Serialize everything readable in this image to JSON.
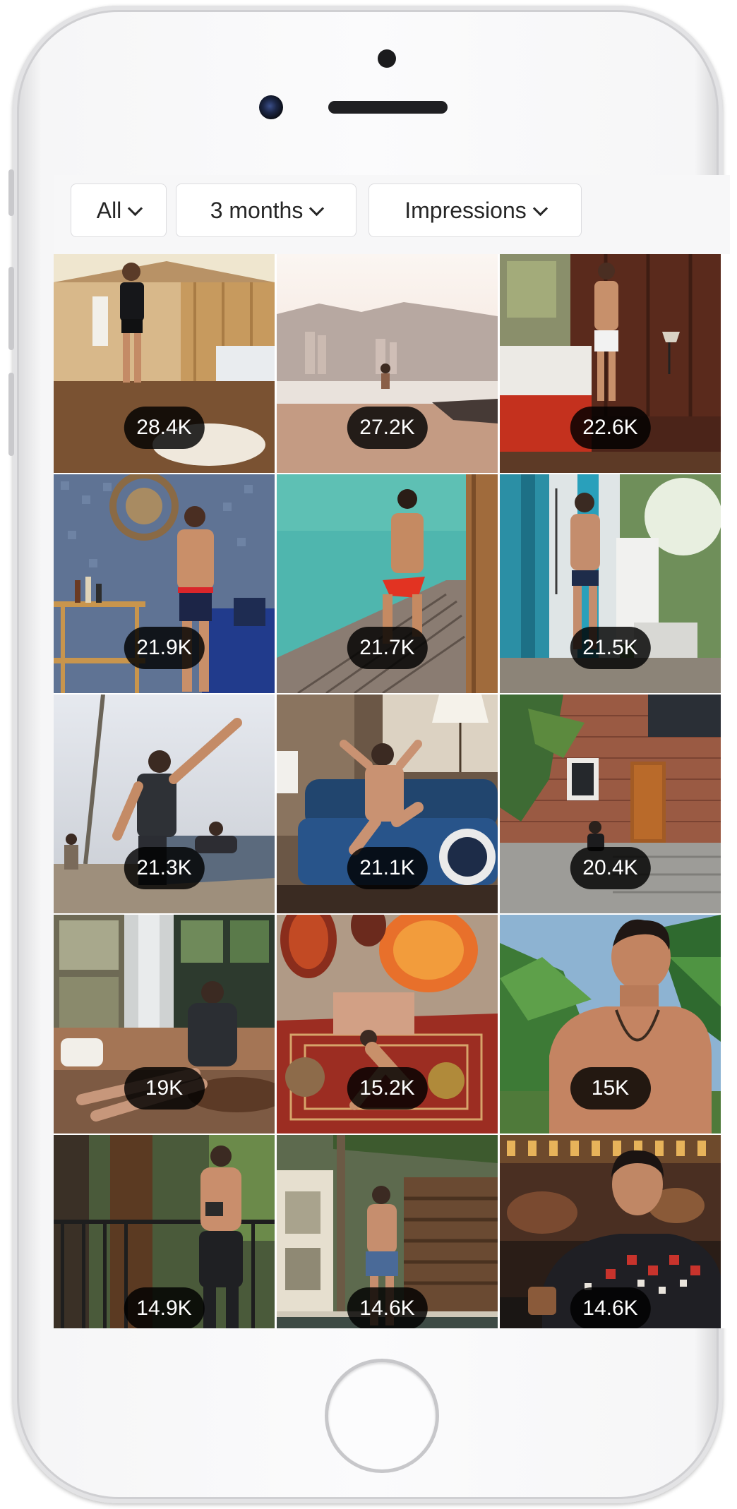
{
  "filters": {
    "content_type": "All",
    "time_range": "3 months",
    "metric": "Impressions"
  },
  "posts": [
    {
      "impressions": "28.4K",
      "scene": "tent-bedroom"
    },
    {
      "impressions": "27.2K",
      "scene": "beach-city"
    },
    {
      "impressions": "22.6K",
      "scene": "red-bedroom"
    },
    {
      "impressions": "21.9K",
      "scene": "mosaic-bar-cart"
    },
    {
      "impressions": "21.7K",
      "scene": "water-dock"
    },
    {
      "impressions": "21.5K",
      "scene": "outdoor-shower"
    },
    {
      "impressions": "21.3K",
      "scene": "beach-yoga"
    },
    {
      "impressions": "21.1K",
      "scene": "blue-sofa"
    },
    {
      "impressions": "20.4K",
      "scene": "brick-house"
    },
    {
      "impressions": "19K",
      "scene": "window-lounge"
    },
    {
      "impressions": "15.2K",
      "scene": "lanterns-rug"
    },
    {
      "impressions": "15K",
      "scene": "palm-portrait"
    },
    {
      "impressions": "14.9K",
      "scene": "forest-balcony"
    },
    {
      "impressions": "14.6K",
      "scene": "tropical-villa"
    },
    {
      "impressions": "14.6K",
      "scene": "bar-sweater"
    }
  ]
}
